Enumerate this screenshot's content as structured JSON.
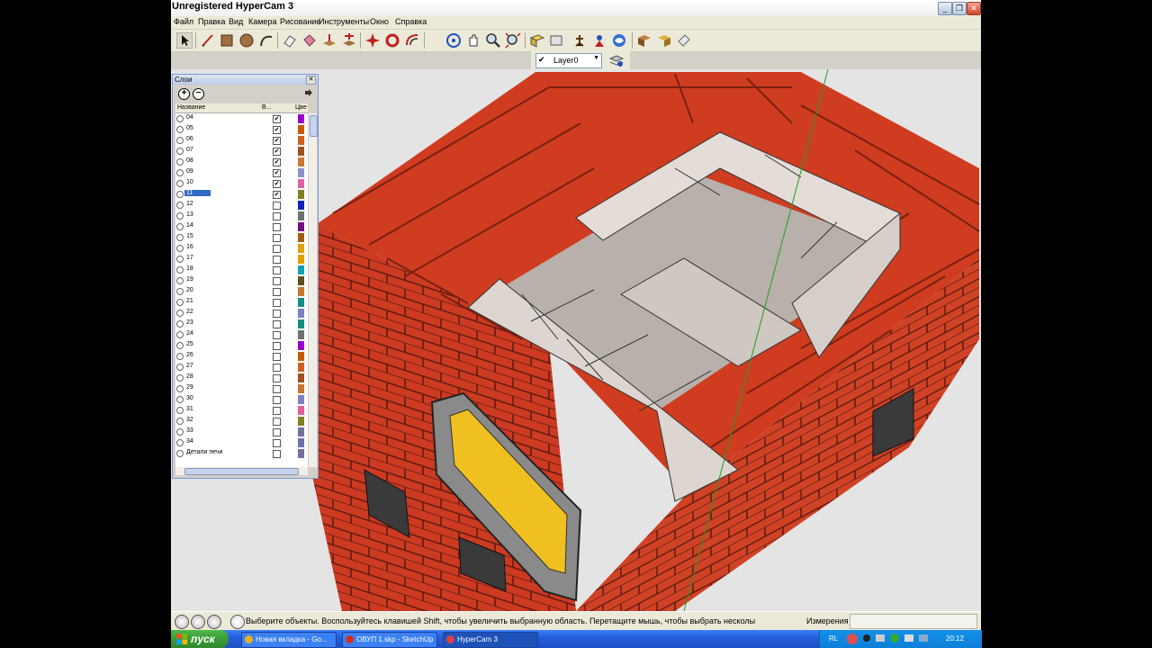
{
  "window": {
    "title": "Unregistered HyperCam 3",
    "caption_buttons": [
      "minimize-icon",
      "restore-icon",
      "close-icon"
    ]
  },
  "menu": [
    "Файл",
    "Правка",
    "Вид",
    "Камера",
    "Рисование",
    "Инструменты",
    "Окно",
    "Справка"
  ],
  "toolbar_icons": [
    "select-arrow-icon",
    "pencil-line-icon",
    "rectangle-icon",
    "circle-icon",
    "arc-icon",
    "eraser-icon",
    "paint-bucket-icon",
    "push-pull-icon",
    "move-icon",
    "rotate-icon",
    "follow-me-icon",
    "orbit-icon",
    "pan-icon",
    "zoom-icon",
    "zoom-extents-icon",
    "component-icon",
    "section-icon",
    "walk-icon",
    "position-camera-icon",
    "look-around-icon"
  ],
  "layer_toolbar": {
    "current_layer": "Layer0"
  },
  "layers_panel": {
    "title": "Слои",
    "columns": {
      "name": "Название",
      "visible": "В...",
      "color": "Цве"
    },
    "rows": [
      {
        "name": "04",
        "visible": true,
        "color": "#9900cc"
      },
      {
        "name": "05",
        "visible": true,
        "color": "#c85a00"
      },
      {
        "name": "06",
        "visible": true,
        "color": "#d06020"
      },
      {
        "name": "07",
        "visible": true,
        "color": "#a05020"
      },
      {
        "name": "08",
        "visible": true,
        "color": "#c87830"
      },
      {
        "name": "09",
        "visible": true,
        "color": "#9090c8"
      },
      {
        "name": "10",
        "visible": true,
        "color": "#e060a0"
      },
      {
        "name": "11",
        "visible": true,
        "color": "#808020",
        "selected": true
      },
      {
        "name": "12",
        "visible": false,
        "color": "#1020c0"
      },
      {
        "name": "13",
        "visible": false,
        "color": "#707070"
      },
      {
        "name": "14",
        "visible": false,
        "color": "#701080"
      },
      {
        "name": "15",
        "visible": false,
        "color": "#a06010"
      },
      {
        "name": "16",
        "visible": false,
        "color": "#e0a000"
      },
      {
        "name": "17",
        "visible": false,
        "color": "#e0a000"
      },
      {
        "name": "18",
        "visible": false,
        "color": "#10a0b0"
      },
      {
        "name": "19",
        "visible": false,
        "color": "#605020"
      },
      {
        "name": "20",
        "visible": false,
        "color": "#c87830"
      },
      {
        "name": "21",
        "visible": false,
        "color": "#109080"
      },
      {
        "name": "22",
        "visible": false,
        "color": "#8080c0"
      },
      {
        "name": "23",
        "visible": false,
        "color": "#109080"
      },
      {
        "name": "24",
        "visible": false,
        "color": "#707070"
      },
      {
        "name": "25",
        "visible": false,
        "color": "#9900cc"
      },
      {
        "name": "26",
        "visible": false,
        "color": "#c85a00"
      },
      {
        "name": "27",
        "visible": false,
        "color": "#d06020"
      },
      {
        "name": "28",
        "visible": false,
        "color": "#a05020"
      },
      {
        "name": "29",
        "visible": false,
        "color": "#c87830"
      },
      {
        "name": "30",
        "visible": false,
        "color": "#8080c0"
      },
      {
        "name": "31",
        "visible": false,
        "color": "#e060a0"
      },
      {
        "name": "32",
        "visible": false,
        "color": "#808020"
      },
      {
        "name": "33",
        "visible": false,
        "color": "#7070a0"
      },
      {
        "name": "34",
        "visible": false,
        "color": "#7070b0"
      },
      {
        "name": "Детали печи",
        "visible": false,
        "color": "#7070a0"
      }
    ]
  },
  "status": {
    "hint": "Выберите объекты. Воспользуйтесь клавишей Shift, чтобы увеличить выбранную область. Перетащите мышь, чтобы выбрать несколы",
    "measure_label": "Измерения",
    "measure_value": ""
  },
  "taskbar": {
    "start_label": "пуск",
    "tasks": [
      {
        "label": "Новая вкладка - Go...",
        "icon": "chrome-icon"
      },
      {
        "label": "ОВУП 1.skp - SketchUp",
        "icon": "sketchup-icon"
      },
      {
        "label": "HyperCam 3",
        "icon": "hypercam-icon",
        "active": true
      }
    ],
    "lang": "RL",
    "clock": "20:12"
  },
  "colors": {
    "brick_red": "#d8391c",
    "firebrick": "#ddd5cf",
    "viewport_bg": "#e4e4e4",
    "xp_blue": "#245edb"
  }
}
